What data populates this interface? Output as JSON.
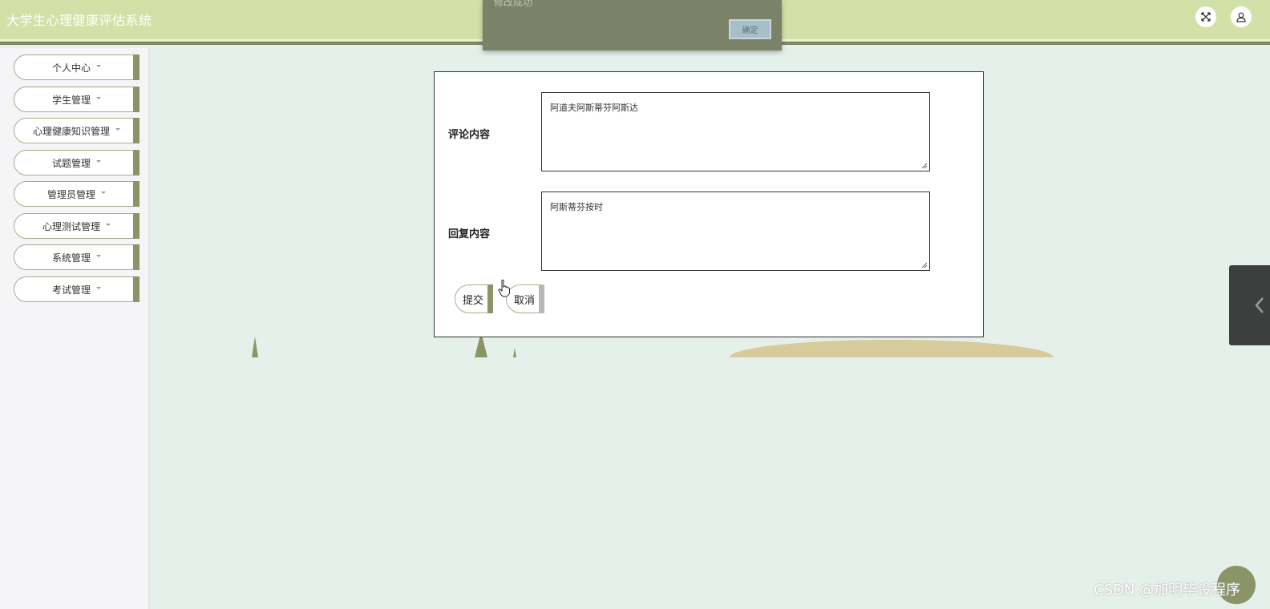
{
  "header": {
    "title": "大学生心理健康评估系统",
    "fullscreen_icon": "fullscreen-icon",
    "user_icon": "user-icon"
  },
  "sidebar": {
    "items": [
      {
        "label": "个人中心"
      },
      {
        "label": "学生管理"
      },
      {
        "label": "心理健康知识管理"
      },
      {
        "label": "试题管理"
      },
      {
        "label": "管理员管理"
      },
      {
        "label": "心理测试管理"
      },
      {
        "label": "系统管理"
      },
      {
        "label": "考试管理"
      }
    ]
  },
  "form": {
    "comment_label": "评论内容",
    "comment_value": "阿道夫阿斯蒂芬阿斯达",
    "reply_label": "回复内容",
    "reply_value": "阿斯蒂芬按时",
    "submit_label": "提交",
    "cancel_label": "取消"
  },
  "toast": {
    "message": "修改成功",
    "confirm_label": "确定"
  },
  "watermark": "CSDN @加明毕设程序",
  "colors": {
    "header_bg": "#d3e1a8",
    "accent": "#8a9466",
    "page_bg": "#e6f0ea",
    "sidebar_bg": "#f5f4f6"
  }
}
